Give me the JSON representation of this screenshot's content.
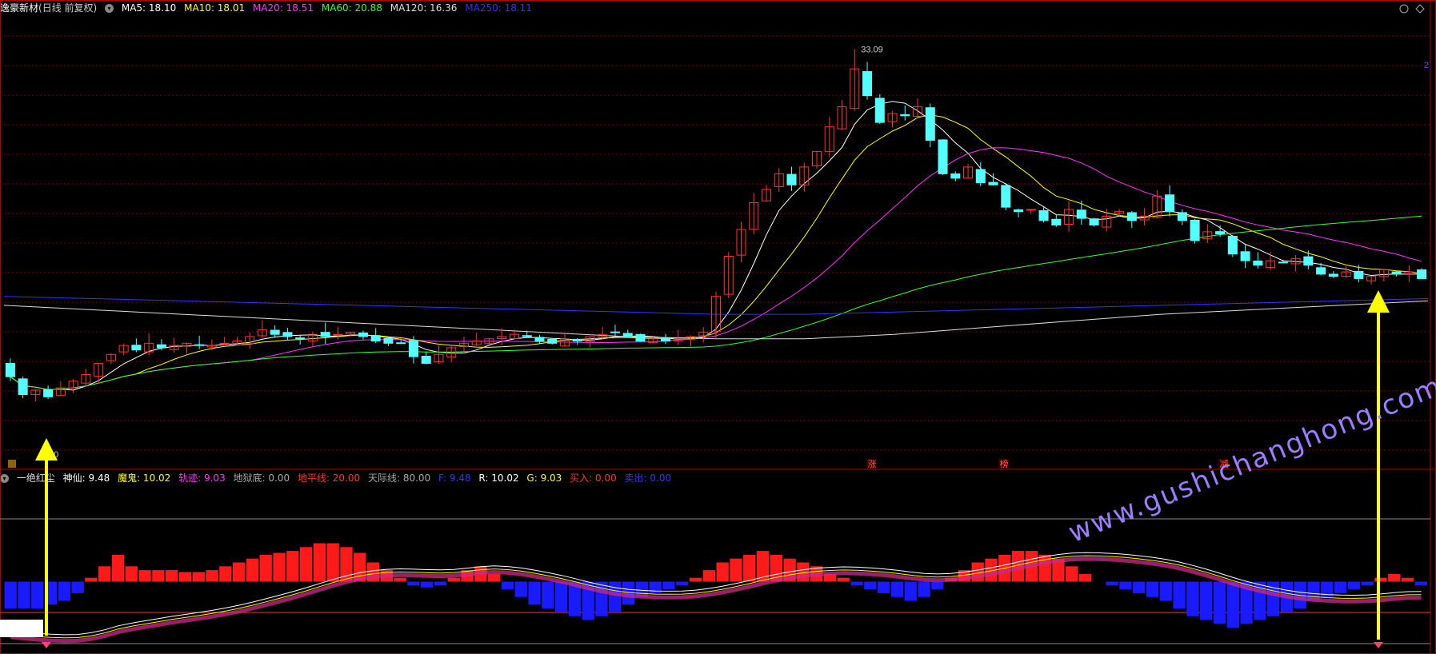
{
  "stock": {
    "name": "逸豪新材",
    "mode": "(日线 前复权)"
  },
  "ma_labels": [
    {
      "text": "MA5: 18.10",
      "color": "#ffffff"
    },
    {
      "text": "MA10: 18.01",
      "color": "#ffff00"
    },
    {
      "text": "MA20: 18.51",
      "color": "#ff33ff"
    },
    {
      "text": "MA60: 20.88",
      "color": "#33ff33"
    },
    {
      "text": "MA120: 16.36",
      "color": "#dddddd"
    },
    {
      "text": "MA250: 18.11",
      "color": "#3333ff"
    }
  ],
  "indicator": {
    "name": "一绝红尘",
    "labels": [
      {
        "text": "神仙: 9.48",
        "color": "#ffffff"
      },
      {
        "text": "魔鬼: 10.02",
        "color": "#ffff00"
      },
      {
        "text": "轨迹: 9.03",
        "color": "#ff33ff"
      },
      {
        "text": "地狱底: 0.00",
        "color": "#aaaaaa"
      },
      {
        "text": "地平线: 20.00",
        "color": "#ff3333"
      },
      {
        "text": "天际线: 80.00",
        "color": "#aaaaaa"
      },
      {
        "text": "F: 9.48",
        "color": "#3333ff"
      },
      {
        "text": "R: 10.02",
        "color": "#ffffff"
      },
      {
        "text": "G: 9.03",
        "color": "#ffff00"
      },
      {
        "text": "买入: 0.00",
        "color": "#ff3333"
      },
      {
        "text": "卖出: 0.00",
        "color": "#3333ff"
      }
    ]
  },
  "annotations": {
    "high_price": "33.09",
    "low_price_suffix": ".40",
    "markers": [
      "涨",
      "榜",
      "减"
    ],
    "watermark": "www.gushichanghong.com",
    "right_edge_digit": "2"
  },
  "colors": {
    "up": "#ff3333",
    "down": "#54ffff",
    "grid": "#7a0000",
    "frame": "#b00000",
    "hist_up": "#ff1a1a",
    "hist_down": "#1a1aff",
    "arrow": "#ffff00",
    "watermark": "#9c7cff"
  },
  "chart_data": [
    {
      "type": "candlestick",
      "title": "逸豪新材 (日线 前复权)",
      "x": "trading days (sequential, left to right)",
      "ylim": [
        14.5,
        34.5
      ],
      "series_close_approx": [
        18.4,
        17.6,
        17.8,
        17.5,
        17.9,
        18.2,
        18.5,
        19.0,
        19.4,
        19.8,
        19.6,
        19.9,
        19.7,
        19.8,
        19.9,
        19.8,
        19.8,
        19.9,
        20.0,
        20.2,
        20.5,
        20.3,
        20.2,
        20.1,
        20.3,
        20.2,
        20.3,
        20.4,
        20.2,
        20.0,
        19.9,
        19.9,
        19.3,
        19.0,
        19.4,
        19.7,
        19.9,
        20.0,
        20.1,
        20.2,
        20.3,
        20.2,
        20.0,
        19.9,
        20.1,
        20.0,
        20.2,
        20.3,
        20.4,
        20.2,
        20.0,
        20.1,
        20.0,
        20.1,
        20.2,
        20.4,
        22.0,
        23.8,
        25.0,
        26.2,
        26.8,
        27.5,
        27.0,
        27.8,
        28.5,
        29.6,
        30.5,
        32.2,
        31.0,
        29.8,
        30.2,
        30.1,
        30.5,
        29.0,
        27.5,
        27.3,
        27.8,
        27.1,
        27.0,
        26.0,
        25.8,
        25.9,
        25.4,
        25.2,
        25.9,
        25.5,
        25.2,
        25.6,
        25.8,
        25.4,
        25.6,
        26.5,
        25.8,
        25.4,
        24.5,
        24.9,
        24.8,
        23.9,
        23.6,
        23.4,
        23.6,
        23.5,
        23.7,
        23.4,
        23.0,
        22.9,
        23.1,
        22.8,
        22.9,
        23.2,
        23.0,
        23.1,
        22.8
      ],
      "high": 33.09,
      "moving_averages": [
        "MA5",
        "MA10",
        "MA20",
        "MA60",
        "MA120",
        "MA250"
      ]
    },
    {
      "type": "bar",
      "title": "一绝红尘",
      "ylim": [
        0,
        100
      ],
      "reference_lines": [
        0,
        20,
        80
      ],
      "histogram": [
        -14,
        -14,
        -14,
        -12,
        -10,
        -6,
        2,
        8,
        14,
        8,
        6,
        6,
        6,
        5,
        5,
        6,
        8,
        10,
        12,
        14,
        15,
        16,
        18,
        20,
        20,
        18,
        15,
        10,
        6,
        2,
        -2,
        -3,
        -2,
        2,
        6,
        8,
        4,
        -4,
        -8,
        -12,
        -14,
        -16,
        -18,
        -20,
        -18,
        -16,
        -12,
        -8,
        -6,
        -4,
        -2,
        2,
        6,
        10,
        12,
        14,
        16,
        14,
        12,
        10,
        8,
        4,
        2,
        -2,
        -4,
        -6,
        -8,
        -10,
        -8,
        -4,
        2,
        6,
        10,
        12,
        14,
        16,
        16,
        14,
        12,
        8,
        4,
        0,
        -2,
        -4,
        -6,
        -8,
        -10,
        -14,
        -18,
        -20,
        -22,
        -24,
        -22,
        -20,
        -18,
        -16,
        -14,
        -10,
        -8,
        -6,
        -4,
        -2,
        2,
        4,
        2,
        -2
      ],
      "series_names": [
        "神仙",
        "魔鬼",
        "轨迹"
      ]
    }
  ]
}
